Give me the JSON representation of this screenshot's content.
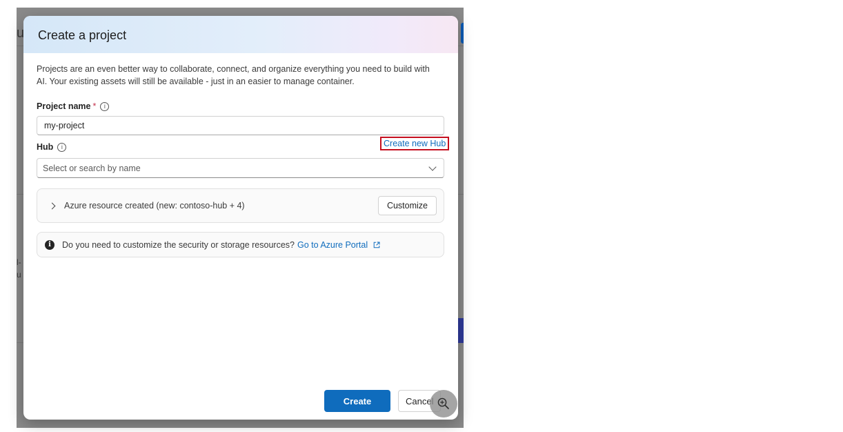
{
  "dialog": {
    "title": "Create a project",
    "intro": "Projects are an even better way to collaborate, connect, and organize everything you need to build with AI. Your existing assets will still be available - just in an easier to manage container."
  },
  "project_name": {
    "label": "Project name",
    "required_mark": "*",
    "value": "my-project"
  },
  "hub": {
    "label": "Hub",
    "create_link": "Create new Hub",
    "placeholder": "Select or search by name"
  },
  "resources": {
    "text": "Azure resource created (new: contoso-hub + 4)",
    "customize_label": "Customize"
  },
  "notice": {
    "text": "Do you need to customize the security or storage resources?",
    "link": "Go to Azure Portal"
  },
  "footer": {
    "create_label": "Create",
    "cancel_label": "Cancel"
  },
  "icons": {
    "info": "info-icon",
    "info_filled": "info-filled-icon",
    "external": "external-link-icon",
    "zoom": "zoom-in-icon"
  },
  "colors": {
    "accent": "#0f6cbd",
    "highlight_border": "#c50f1f",
    "required": "#c4314b"
  }
}
